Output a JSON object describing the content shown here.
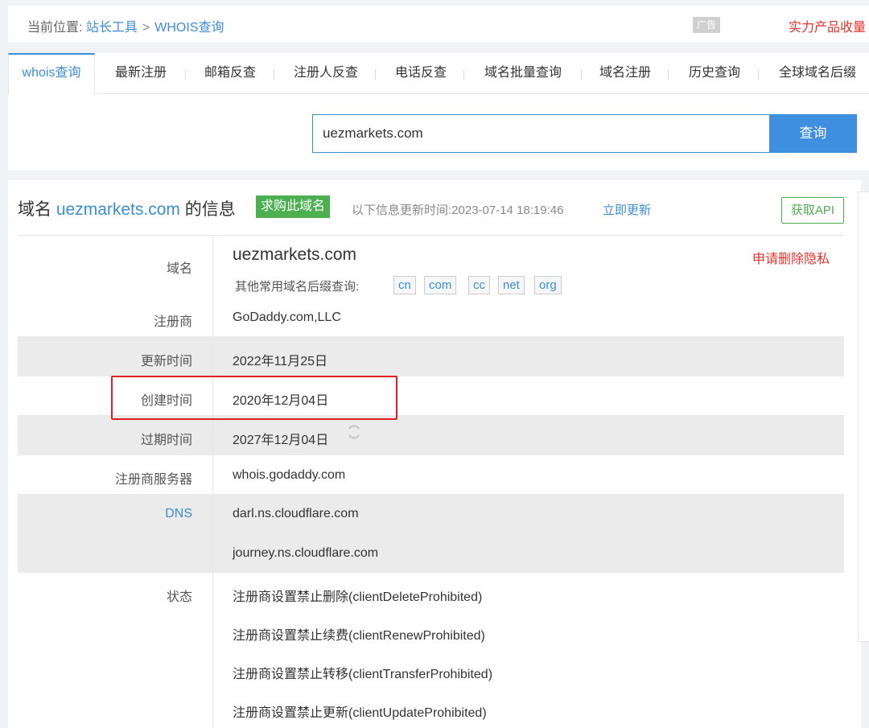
{
  "breadcrumb": {
    "prefix": "当前位置:",
    "link1": "站长工具",
    "separator": ">",
    "link2": "WHOIS查询"
  },
  "ad": {
    "badge": "广告",
    "text": "实力产品收量"
  },
  "tabs": [
    {
      "label": "whois查询",
      "active": true
    },
    {
      "label": "最新注册"
    },
    {
      "label": "邮箱反查"
    },
    {
      "label": "注册人反查"
    },
    {
      "label": "电话反查"
    },
    {
      "label": "域名批量查询"
    },
    {
      "label": "域名注册"
    },
    {
      "label": "历史查询"
    },
    {
      "label": "全球域名后缀"
    }
  ],
  "search": {
    "value": "uezmarkets.com",
    "button": "查询"
  },
  "info": {
    "title_prefix": "域名",
    "domain": "uezmarkets.com",
    "title_suffix": "的信息",
    "buy_badge": "求购此域名",
    "update_text": "以下信息更新时间:2023-07-14 18:19:46",
    "update_link": "立即更新",
    "api_button": "获取API"
  },
  "whois": {
    "domain_label": "域名",
    "domain_value": "uezmarkets.com",
    "privacy_link": "申请删除隐私",
    "suffix_label": "其他常用域名后缀查询:",
    "suffixes": [
      "cn",
      "com",
      "cc",
      "net",
      "org"
    ],
    "registrar_label": "注册商",
    "registrar_value": "GoDaddy.com,LLC",
    "updated_label": "更新时间",
    "updated_value": "2022年11月25日",
    "created_label": "创建时间",
    "created_value": "2020年12月04日",
    "expires_label": "过期时间",
    "expires_value": "2027年12月04日",
    "server_label": "注册商服务器",
    "server_value": "whois.godaddy.com",
    "dns_label": "DNS",
    "dns": [
      "darl.ns.cloudflare.com",
      "journey.ns.cloudflare.com"
    ],
    "status_label": "状态",
    "status": [
      "注册商设置禁止删除(clientDeleteProhibited)",
      "注册商设置禁止续费(clientRenewProhibited)",
      "注册商设置禁止转移(clientTransferProhibited)",
      "注册商设置禁止更新(clientUpdateProhibited)"
    ]
  },
  "colors": {
    "accent": "#3b8ed6",
    "green": "#4caf50",
    "red": "#e3322d"
  }
}
